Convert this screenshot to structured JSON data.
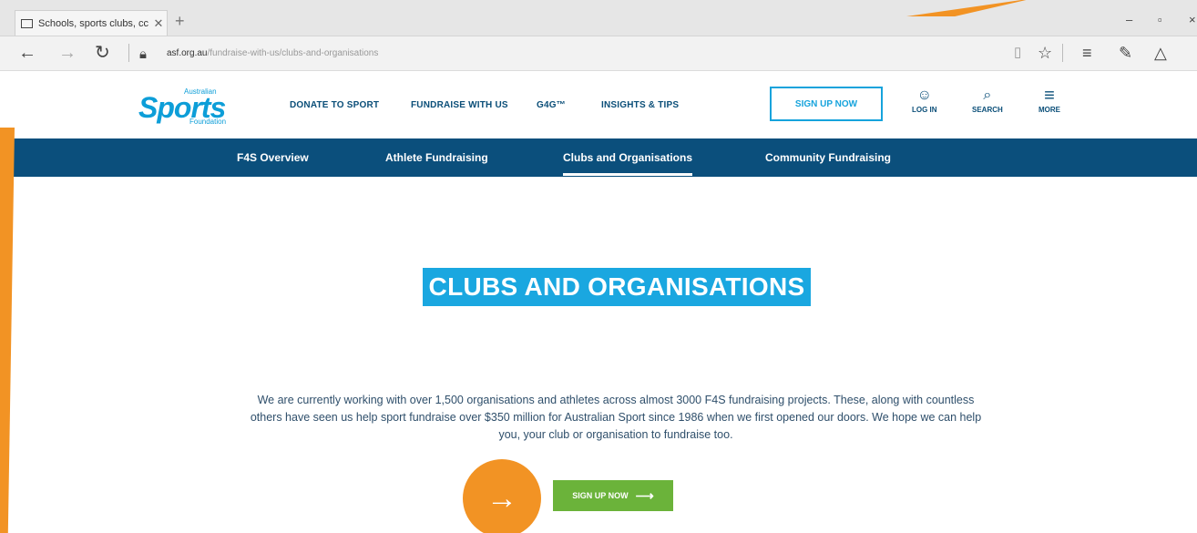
{
  "browser": {
    "tab_title": "Schools, sports clubs, cc",
    "tab_close": "✕",
    "new_tab": "+",
    "url_host": "asf.org.au",
    "url_path": "/fundraise-with-us/clubs-and-organisations"
  },
  "site": {
    "logo_top": "Australian",
    "logo_main": "Sports",
    "logo_sub": "Foundation",
    "nav": {
      "donate": "DONATE TO SPORT",
      "fundraise": "FUNDRAISE WITH US",
      "g4g": "G4G™",
      "insights": "INSIGHTS & TIPS"
    },
    "signup": "SIGN UP NOW",
    "tools": {
      "login": "LOG IN",
      "search": "SEARCH",
      "more": "MORE"
    }
  },
  "subnav": {
    "overview": "F4S Overview",
    "athlete": "Athlete Fundraising",
    "clubs": "Clubs and Organisations",
    "community": "Community Fundraising"
  },
  "main": {
    "heading": "CLUBS AND ORGANISATIONS",
    "intro": "We are currently working with over 1,500 organisations and athletes across almost 3000 F4S fundraising projects. These, along with countless others have seen us help sport fundraise over $350 million for Australian Sport since 1986 when we first opened our doors. We hope we can help you, your club or organisation to fundraise too.",
    "cta": "SIGN UP NOW"
  },
  "colors": {
    "brand_blue": "#0d9ed8",
    "nav_dark": "#0b4f7c",
    "cta_green": "#6bb33a",
    "accent_orange": "#f29324"
  }
}
